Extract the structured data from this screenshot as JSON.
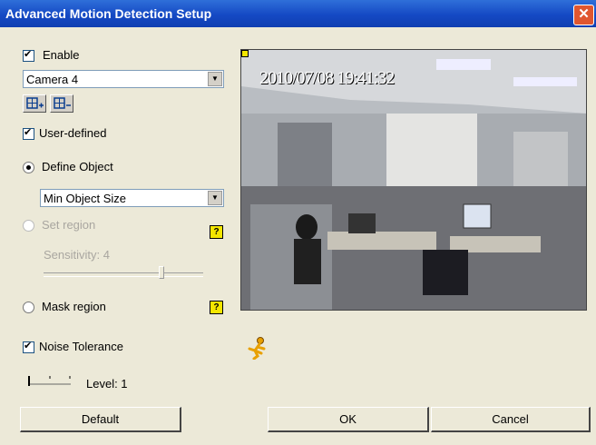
{
  "window": {
    "title": "Advanced Motion Detection Setup",
    "close_glyph": "✕"
  },
  "enable": {
    "label": "Enable",
    "checked": true
  },
  "camera_select": {
    "value": "Camera 4"
  },
  "user_defined": {
    "label": "User-defined",
    "checked": true
  },
  "define_object": {
    "label": "Define Object",
    "selected": true
  },
  "object_size_select": {
    "value": "Min Object Size"
  },
  "set_region": {
    "label": "Set region",
    "enabled": false
  },
  "sensitivity": {
    "label": "Sensitivity: 4",
    "value": 4
  },
  "mask_region": {
    "label": "Mask region"
  },
  "noise_tolerance": {
    "label": "Noise Tolerance",
    "checked": true
  },
  "level": {
    "label": "Level: 1",
    "value": 1
  },
  "video": {
    "timestamp": "2010/07/08 19:41:32"
  },
  "buttons": {
    "default": "Default",
    "ok": "OK",
    "cancel": "Cancel"
  },
  "help_glyph": "?",
  "colors": {
    "titlebar": "#1549c4",
    "dialog_bg": "#ece9d8",
    "help_icon": "#f4e600"
  }
}
